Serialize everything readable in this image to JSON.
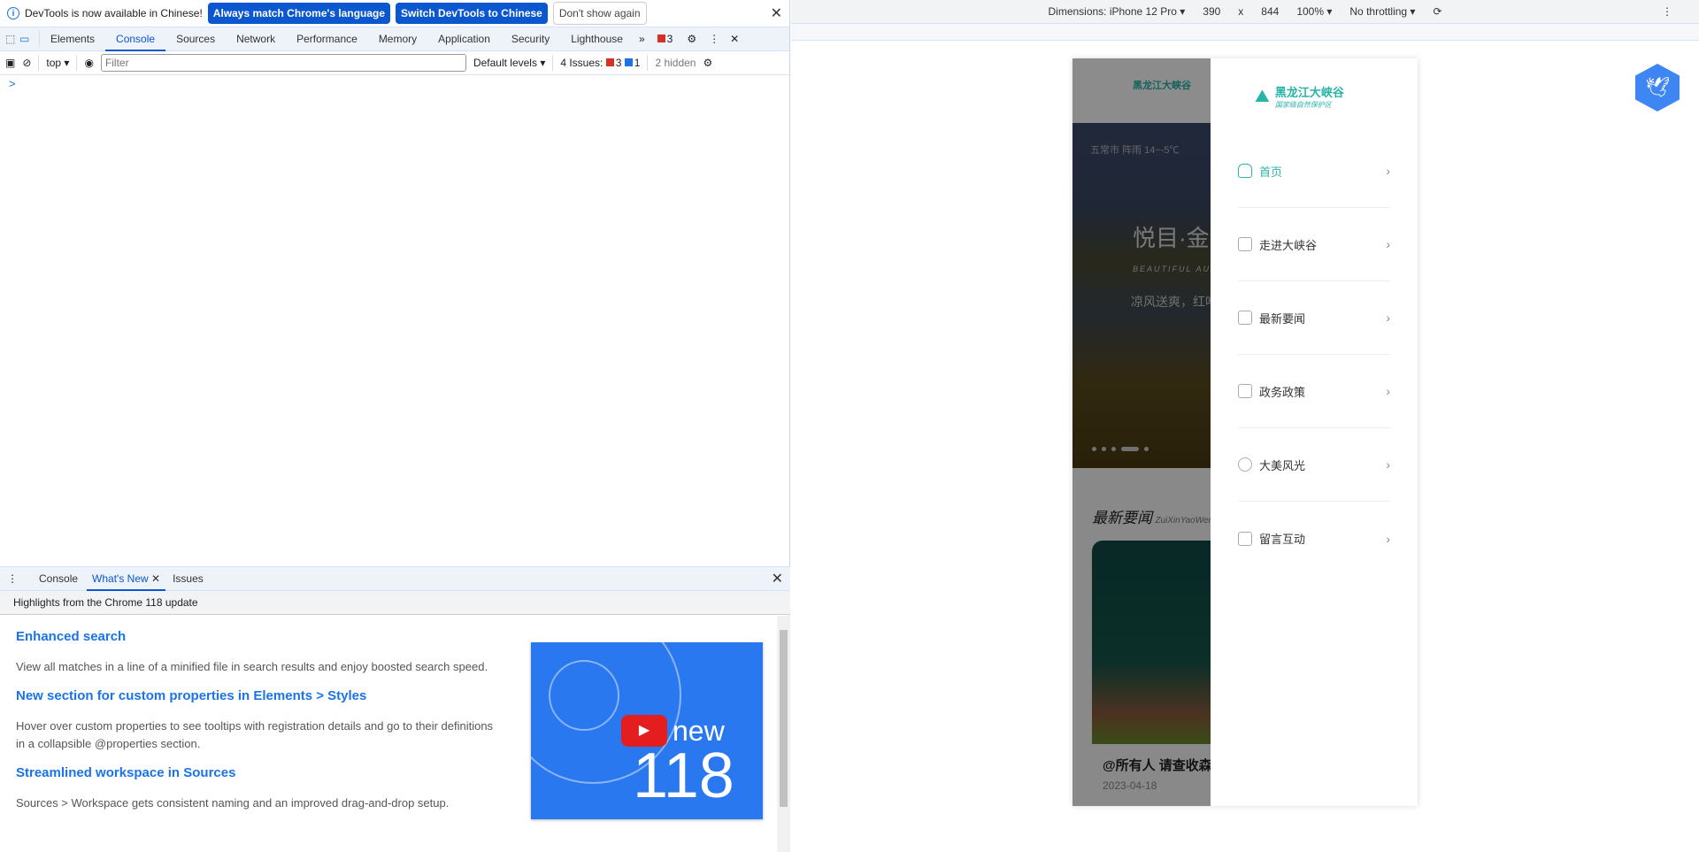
{
  "banner": {
    "text": "DevTools is now available in Chinese!",
    "btn1": "Always match Chrome's language",
    "btn2": "Switch DevTools to Chinese",
    "btn3": "Don't show again"
  },
  "tabs": [
    "Elements",
    "Console",
    "Sources",
    "Network",
    "Performance",
    "Memory",
    "Application",
    "Security",
    "Lighthouse"
  ],
  "issues_badge": "3",
  "console": {
    "context": "top",
    "filter_placeholder": "Filter",
    "levels": "Default levels",
    "issues_label": "4 Issues:",
    "err": "3",
    "info": "1",
    "hidden": "2 hidden",
    "prompt": ">"
  },
  "drawer": {
    "tabs": [
      "Console",
      "What's New",
      "Issues"
    ],
    "subtitle": "Highlights from the Chrome 118 update",
    "items": [
      {
        "title": "Enhanced search",
        "desc": "View all matches in a line of a minified file in search results and enjoy boosted search speed."
      },
      {
        "title": "New section for custom properties in Elements > Styles",
        "desc": "Hover over custom properties to see tooltips with registration details and go to their definitions in a collapsible @properties section."
      },
      {
        "title": "Streamlined workspace in Sources",
        "desc": "Sources > Workspace gets consistent naming and an improved drag-and-drop setup."
      }
    ],
    "thumb_new": "new",
    "thumb_num": "118"
  },
  "device": {
    "dimensions": "Dimensions: iPhone 12 Pro",
    "width": "390",
    "x": "x",
    "height": "844",
    "zoom": "100%",
    "throttle": "No throttling"
  },
  "site": {
    "logo_title": "黑龙江大峡谷",
    "logo_sub": "国家级自然保护区",
    "weather": "五常市  阵雨  14~-5℃",
    "hero_title": "悦目·金",
    "hero_en": "BEAUTIFUL AUTU",
    "hero_sub": "凉风送爽，红叶飞",
    "section": "最新要闻",
    "section_en": "ZuiXinYaoWen",
    "news_title": "@所有人 请查收森",
    "news_date": "2023-04-18",
    "menu": [
      {
        "label": "首页",
        "icon": "home-icon"
      },
      {
        "label": "走进大峡谷",
        "icon": "mountain-icon"
      },
      {
        "label": "最新要闻",
        "icon": "book-icon"
      },
      {
        "label": "政务政策",
        "icon": "box-icon"
      },
      {
        "label": "大美风光",
        "icon": "sun-icon"
      },
      {
        "label": "留言互动",
        "icon": "edit-icon"
      }
    ]
  },
  "colors": {
    "accent": "#1a73e8",
    "brand": "#2bb3a8"
  }
}
